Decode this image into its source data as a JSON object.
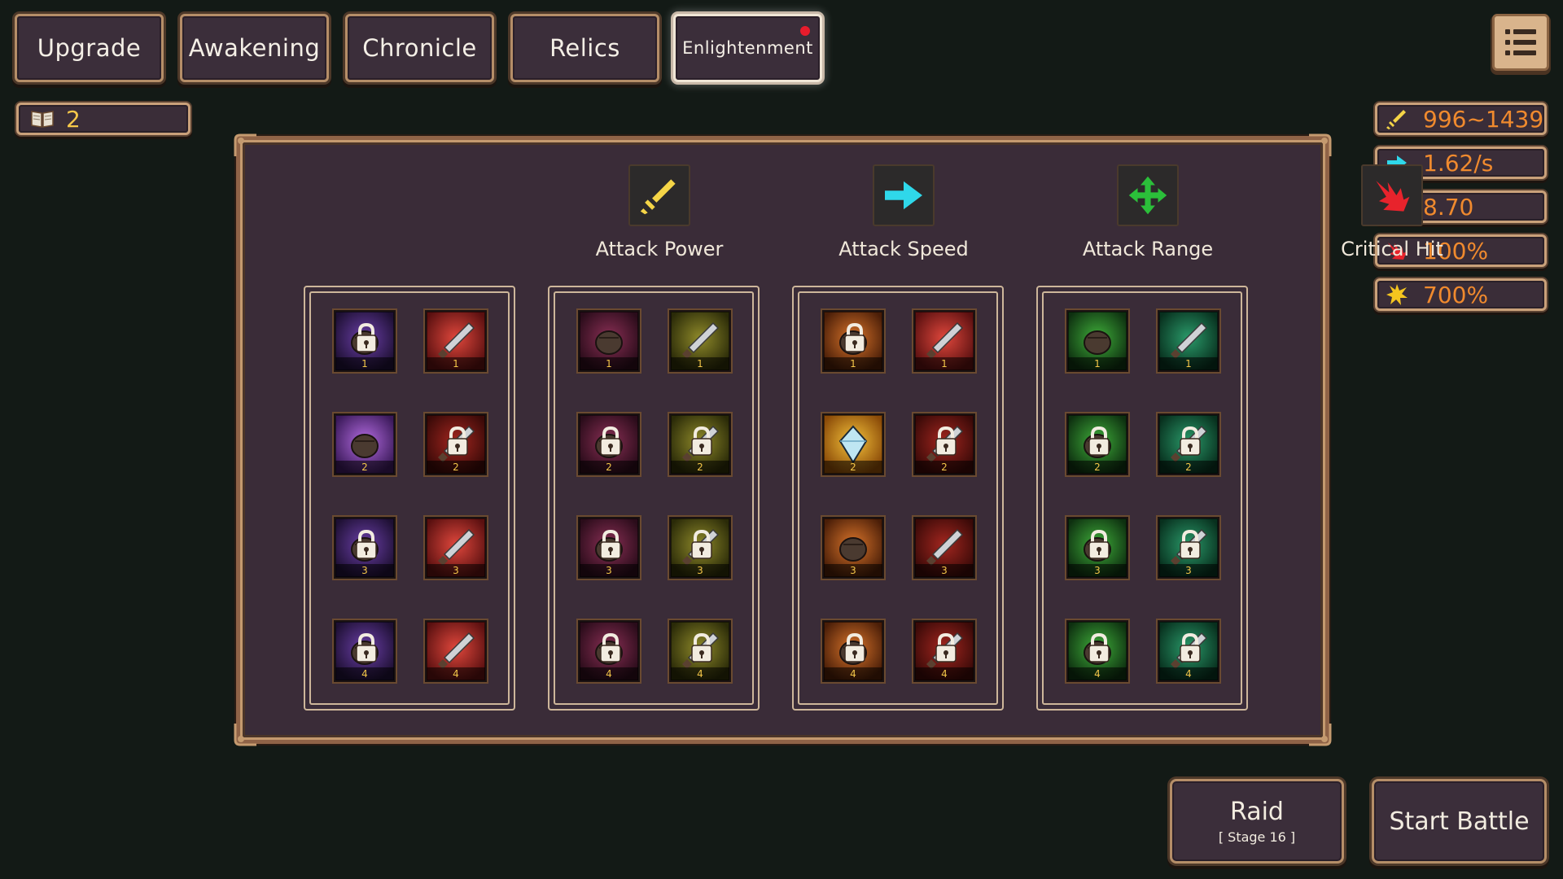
{
  "tabs": [
    {
      "label": "Upgrade",
      "active": false
    },
    {
      "label": "Awakening",
      "active": false
    },
    {
      "label": "Chronicle",
      "active": false
    },
    {
      "label": "Relics",
      "active": false
    },
    {
      "label": "Enlightenment",
      "active": true,
      "notification": true
    }
  ],
  "book": {
    "icon": "book-icon",
    "count": "2"
  },
  "stats": [
    {
      "icon": "sword-icon",
      "color": "#f5d547",
      "value": "996~1439"
    },
    {
      "icon": "arrow-right-icon",
      "color": "#2fd8ea",
      "value": "1.62/s"
    },
    {
      "icon": "move-cross-icon",
      "color": "#2bbf3a",
      "value": "8.70"
    },
    {
      "icon": "critical-burst-icon",
      "color": "#e8232c",
      "value": "100%"
    },
    {
      "icon": "star-burst-icon",
      "color": "#f5c51f",
      "value": "700%"
    }
  ],
  "columns": [
    {
      "key": "attack-power",
      "label": "Attack Power",
      "icon": "sword-icon",
      "accent": "#f5d547",
      "tiles": [
        {
          "level": "1",
          "locked": true,
          "theme": "purple"
        },
        {
          "level": "1",
          "locked": false,
          "theme": "red"
        },
        {
          "level": "2",
          "locked": false,
          "theme": "violet"
        },
        {
          "level": "2",
          "locked": true,
          "theme": "darkred"
        },
        {
          "level": "3",
          "locked": true,
          "theme": "purple"
        },
        {
          "level": "3",
          "locked": false,
          "theme": "red"
        },
        {
          "level": "4",
          "locked": true,
          "theme": "purple"
        },
        {
          "level": "4",
          "locked": false,
          "theme": "red"
        }
      ]
    },
    {
      "key": "attack-speed",
      "label": "Attack Speed",
      "icon": "arrow-right-icon",
      "accent": "#2fd8ea",
      "tiles": [
        {
          "level": "1",
          "locked": false,
          "theme": "maroon"
        },
        {
          "level": "1",
          "locked": false,
          "theme": "olive"
        },
        {
          "level": "2",
          "locked": true,
          "theme": "maroon"
        },
        {
          "level": "2",
          "locked": true,
          "theme": "olive"
        },
        {
          "level": "3",
          "locked": true,
          "theme": "maroon"
        },
        {
          "level": "3",
          "locked": true,
          "theme": "olive"
        },
        {
          "level": "4",
          "locked": true,
          "theme": "maroon"
        },
        {
          "level": "4",
          "locked": true,
          "theme": "olive"
        }
      ]
    },
    {
      "key": "attack-range",
      "label": "Attack Range",
      "icon": "move-cross-icon",
      "accent": "#2bbf3a",
      "tiles": [
        {
          "level": "1",
          "locked": true,
          "theme": "orange"
        },
        {
          "level": "1",
          "locked": false,
          "theme": "red"
        },
        {
          "level": "2",
          "locked": false,
          "theme": "gold"
        },
        {
          "level": "2",
          "locked": true,
          "theme": "darkred"
        },
        {
          "level": "3",
          "locked": false,
          "theme": "orange"
        },
        {
          "level": "3",
          "locked": false,
          "theme": "darkred"
        },
        {
          "level": "4",
          "locked": true,
          "theme": "orange"
        },
        {
          "level": "4",
          "locked": true,
          "theme": "darkred"
        }
      ]
    },
    {
      "key": "critical-hit",
      "label": "Critical Hit",
      "icon": "critical-burst-icon",
      "accent": "#e8232c",
      "tiles": [
        {
          "level": "1",
          "locked": false,
          "theme": "green"
        },
        {
          "level": "1",
          "locked": false,
          "theme": "teal"
        },
        {
          "level": "2",
          "locked": true,
          "theme": "green"
        },
        {
          "level": "2",
          "locked": true,
          "theme": "teal"
        },
        {
          "level": "3",
          "locked": true,
          "theme": "green"
        },
        {
          "level": "3",
          "locked": true,
          "theme": "teal"
        },
        {
          "level": "4",
          "locked": true,
          "theme": "green"
        },
        {
          "level": "4",
          "locked": true,
          "theme": "teal"
        }
      ]
    }
  ],
  "buttons": {
    "raid_label": "Raid",
    "raid_sub": "[ Stage 16 ]",
    "start_label": "Start Battle"
  }
}
